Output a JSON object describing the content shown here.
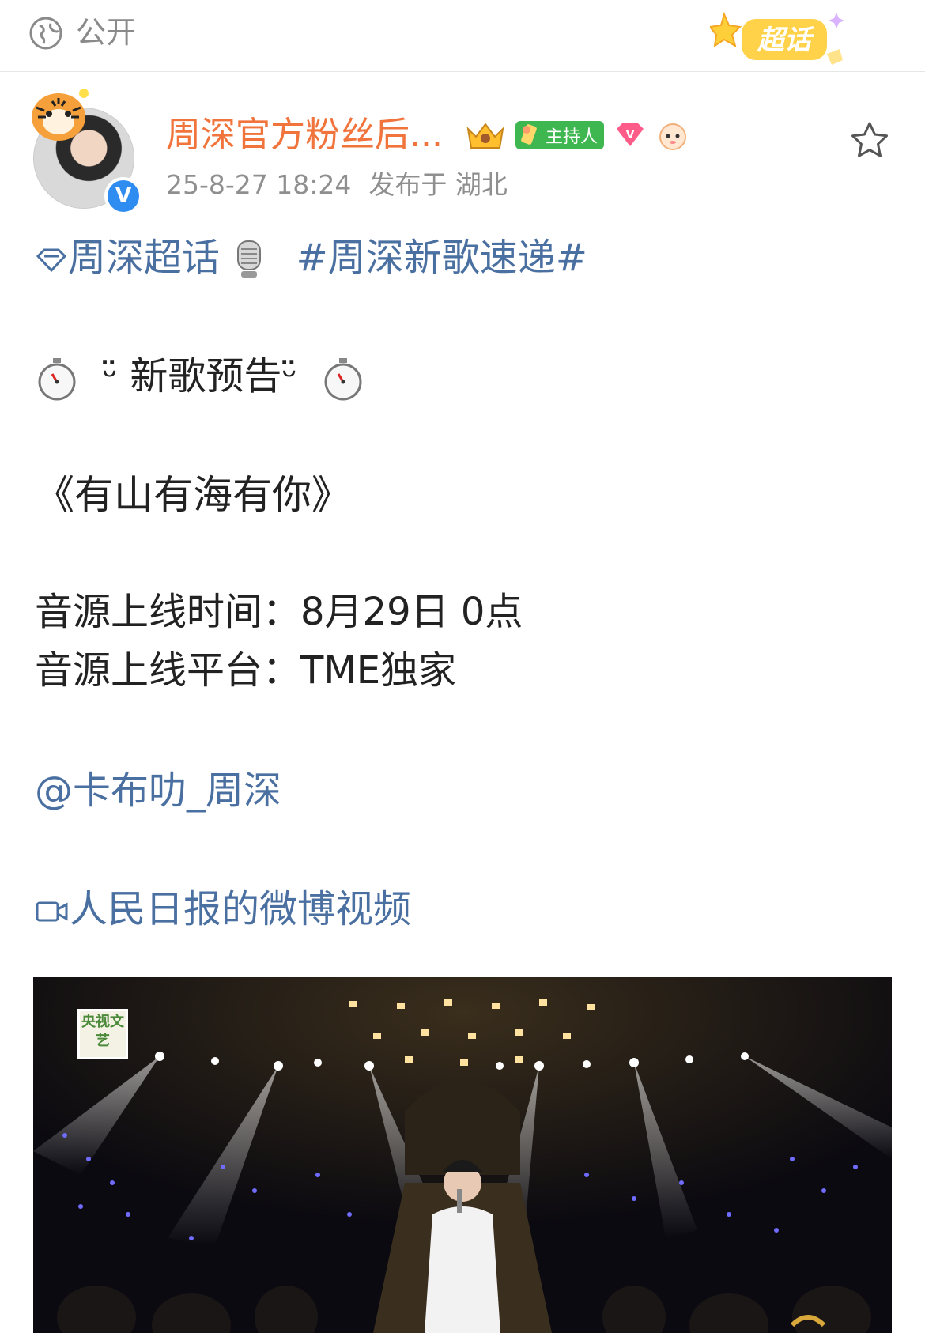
{
  "topbar": {
    "visibility_label": "公开",
    "supertopic_badge": "超话"
  },
  "post": {
    "author": "周深官方粉丝后...",
    "host_badge": "主持人",
    "timestamp": "25-8-27 18:24",
    "location": "发布于 湖北",
    "supertopic_link": "周深超话",
    "hashtag": "#周深新歌速递#",
    "announcement": "ᵕ̈ 新歌预告ᵕ̈",
    "song_title": "《有山有海有你》",
    "release_time_label": "音源上线时间：",
    "release_time_value": "8月29日 0点",
    "platform_label": "音源上线平台：",
    "platform_value": "TME独家",
    "mention": "@卡布叻_周深",
    "video_link": "人民日报的微博视频"
  },
  "video": {
    "channel_logo_text": "央视文艺"
  },
  "colors": {
    "link_blue": "#4a6fa1",
    "username_orange": "#f0743b",
    "meta_gray": "#8f8f8f"
  }
}
